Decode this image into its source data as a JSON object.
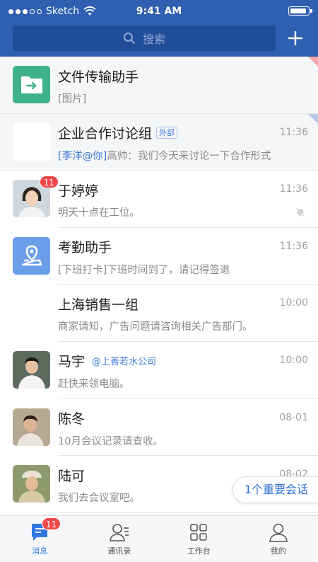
{
  "status_bar": {
    "carrier": "Sketch",
    "time": "9:41 AM"
  },
  "search": {
    "placeholder": "搜索"
  },
  "conversations": [
    {
      "title": "文件传输助手",
      "preview": "[图片]",
      "time": ""
    },
    {
      "title": "企业合作讨论组",
      "tag": "外部",
      "mention": "[李洋@你]",
      "preview": "高帅：我们今天来讨论一下合作形式",
      "time": "11:36"
    },
    {
      "title": "于婷婷",
      "preview": "明天十点在工位。",
      "time": "11:36",
      "badge": "11"
    },
    {
      "title": "考勤助手",
      "preview": "[下班打卡]下班时间到了，请记得签退",
      "time": "11:36"
    },
    {
      "title": "上海销售一组",
      "preview": "商家请知，广告问题请咨询相关广告部门。",
      "time": "10:00"
    },
    {
      "title": "马宇",
      "tag": "@上善若水公司",
      "preview": "赶快来领电脑。",
      "time": "10:00"
    },
    {
      "title": "陈冬",
      "preview": "10月会议记录请查收。",
      "time": "08-01"
    },
    {
      "title": "陆可",
      "preview": "我们去会议室吧。",
      "time": "08-02"
    }
  ],
  "floating_pill": {
    "label": "1个重要会话"
  },
  "tabs": [
    {
      "label": "消息",
      "badge": "11"
    },
    {
      "label": "通讯录"
    },
    {
      "label": "工作台"
    },
    {
      "label": "我的"
    }
  ],
  "colors": {
    "header": "#2f5fb0",
    "accent": "#3077e3",
    "badge": "#f04848"
  }
}
